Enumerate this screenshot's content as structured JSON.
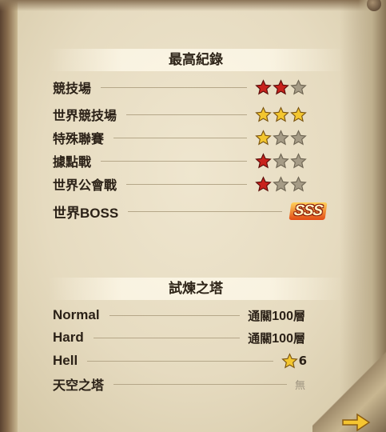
{
  "records": {
    "title": "最高紀錄",
    "rows": [
      {
        "label": "競技場",
        "stars": [
          "red",
          "red",
          "empty"
        ]
      },
      {
        "label": "世界競技場",
        "stars": [
          "gold",
          "gold",
          "gold"
        ]
      },
      {
        "label": "特殊聯賽",
        "stars": [
          "gold",
          "empty",
          "empty"
        ]
      },
      {
        "label": "據點戰",
        "stars": [
          "red",
          "empty",
          "empty"
        ]
      },
      {
        "label": "世界公會戰",
        "stars": [
          "red",
          "empty",
          "empty"
        ]
      },
      {
        "label": "世界BOSS",
        "rank": "SSS"
      }
    ]
  },
  "tower": {
    "title": "試煉之塔",
    "rows": [
      {
        "label": "Normal",
        "prefix": "通關",
        "floor": "100",
        "suffix": "層"
      },
      {
        "label": "Hard",
        "prefix": "通關",
        "floor": "100",
        "suffix": "層"
      },
      {
        "label": "Hell",
        "stars": "6"
      },
      {
        "label": "天空之塔",
        "value": "無"
      }
    ]
  },
  "colors": {
    "gold_star": "#f3c62f",
    "red_star": "#c8221c",
    "empty_star": "#a59b86",
    "text": "#2b2117",
    "page": "#e8dec5"
  },
  "icons": {
    "star": "star-icon",
    "next": "next-page-arrow-icon"
  }
}
